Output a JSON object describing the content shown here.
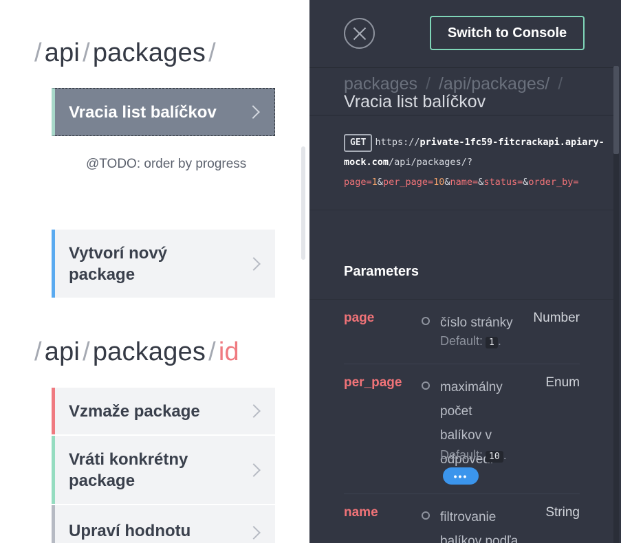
{
  "left": {
    "group1": {
      "segments": [
        "api",
        "packages"
      ]
    },
    "action_list_packages": "Vracia list balíčkov",
    "description": "@TODO: order by progress",
    "action_create_package": "Vytvorí nový package",
    "group2": {
      "segments": [
        "api",
        "packages"
      ],
      "param": "id"
    },
    "action_delete_package": "Vzmaže package",
    "action_get_package": "Vráti konkrétny package",
    "action_update_value": "Upraví hodnotu"
  },
  "right": {
    "console_button": "Switch to Console",
    "breadcrumbs": [
      "packages",
      "/api/packages/"
    ],
    "breadcrumb_separator": "/",
    "action_title": "Vracia list balíčkov",
    "request": {
      "method": "GET",
      "url_prefix": "https://",
      "host": "private-1fc59-fitcrackapi.apiary-mock.com",
      "path": "/api/packages/?",
      "query": [
        {
          "key": "page",
          "value": "1"
        },
        {
          "key": "per_page",
          "value": "10"
        },
        {
          "key": "name",
          "value": ""
        },
        {
          "key": "status",
          "value": ""
        },
        {
          "key": "order_by",
          "value": ""
        }
      ]
    },
    "parameters_title": "Parameters",
    "parameters": [
      {
        "name": "page",
        "description": "číslo stránky",
        "type": "Number",
        "default_label": "Default:",
        "default": "1"
      },
      {
        "name": "per_page",
        "description": "maximálny počet balíkov v odpovedi",
        "type": "Enum",
        "default_label": "Default:",
        "default": "10",
        "more_label": "•••"
      },
      {
        "name": "name",
        "description": "filtrovanie balíkov podľa",
        "type": "String"
      }
    ]
  },
  "colors": {
    "left_bg": "#ffffff",
    "right_bg": "#323642",
    "param_red": "#f07378",
    "console_border": "#7fd6b8",
    "selected_action_bg": "#7a8392"
  }
}
